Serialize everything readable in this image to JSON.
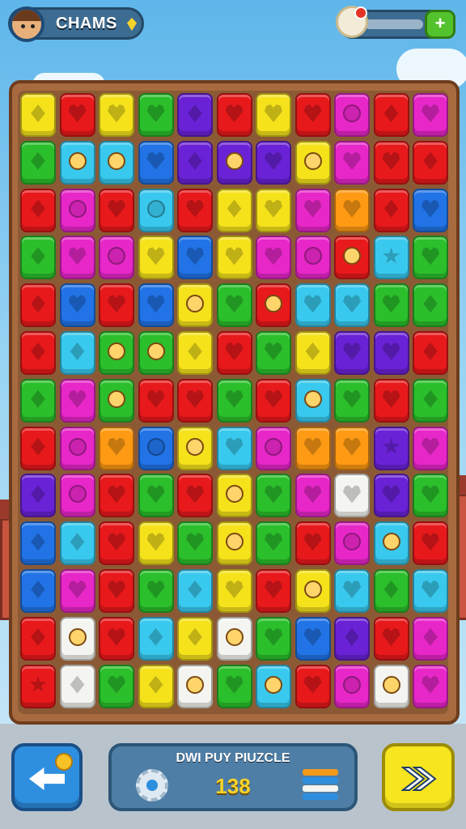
{
  "header": {
    "player_name": "CHAMS",
    "energy_plus_label": "+",
    "icons": {
      "avatar": "player-avatar",
      "gem": "gem-icon",
      "energy": "sheep-icon"
    }
  },
  "board": {
    "rows": 13,
    "cols": 11,
    "palette": {
      "Y": "#f5e21b",
      "R": "#e8191b",
      "G": "#2bbf2b",
      "P": "#e727c8",
      "B": "#2173e6",
      "C": "#39c9ee",
      "V": "#6a22d6",
      "O": "#ff9a14",
      "W": "#f4f4f0"
    },
    "grid": [
      "YRYGVRYRPRP",
      "GCCBVVVYPRR",
      "RPRCRYYPORB",
      "GPPYBYPPRCG",
      "RBRBYGRCCGG",
      "RCGGYRGYVVR",
      "GPGRRGRCGRG",
      "RPOBYCPOOVP",
      "VPRGRYGPWVG",
      "BCRYGYGRPCR",
      "BPRGCYRYCGC",
      "RWRCYWGBVRP",
      "RWGYWGCRPWP"
    ],
    "symbols": [
      "DHHHDHHHCDH",
      "DFFHDFHFHHD",
      "DCHCHDHHHDH",
      "DHCHHHHCFSH",
      "DHHHFHFHHHD",
      "DDFFDHHDHHD",
      "DHFHHHHFHHD",
      "DCHCFHCHHSH",
      "DCHHHFHHHHH",
      "DDHHHFHHCFH",
      "DHHHDHHFHDH",
      "DFHDDFHHDHD",
      "SDHDFHFHCFH"
    ]
  },
  "footer": {
    "game_title": "DWI PUY PIUZCLE",
    "score": "138",
    "icons": {
      "back": "back-arrow-icon",
      "settings": "gear-icon",
      "stack": "stack-icon",
      "next": "fast-forward-icon"
    }
  },
  "colors": {
    "frame": "#a86b3f",
    "accent_blue": "#2e8fe0",
    "accent_yellow": "#f6e51f"
  }
}
